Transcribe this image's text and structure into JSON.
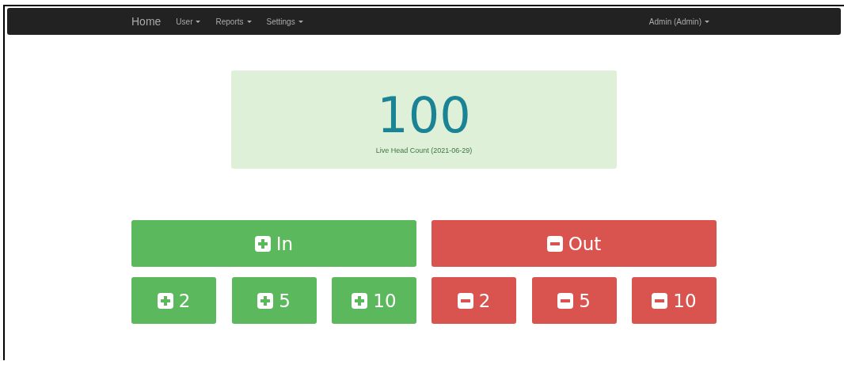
{
  "navbar": {
    "brand": "Home",
    "menus": [
      "User",
      "Reports",
      "Settings"
    ],
    "user": "Admin (Admin)"
  },
  "counter": {
    "value": "100",
    "label": "Live Head Count (2021-06-29)"
  },
  "groups": [
    {
      "kind": "in",
      "label": "In",
      "steps": [
        "2",
        "5",
        "10"
      ]
    },
    {
      "kind": "out",
      "label": "Out",
      "steps": [
        "2",
        "5",
        "10"
      ]
    }
  ]
}
